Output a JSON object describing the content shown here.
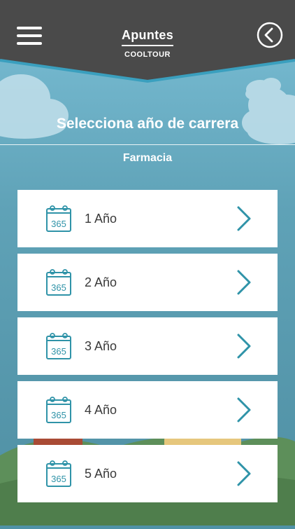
{
  "header": {
    "title": "Apuntes",
    "subtitle": "COOLTOUR"
  },
  "main": {
    "heading": "Selecciona año de carrera",
    "career": "Farmacia",
    "years": [
      {
        "label": "1 Año",
        "icon_text": "365"
      },
      {
        "label": "2 Año",
        "icon_text": "365"
      },
      {
        "label": "3 Año",
        "icon_text": "365"
      },
      {
        "label": "4 Año",
        "icon_text": "365"
      },
      {
        "label": "5 Año",
        "icon_text": "365"
      }
    ]
  },
  "icons": {
    "menu": "hamburger-menu-icon",
    "back": "chevron-left-circle-icon",
    "calendar": "calendar-365-icon",
    "chevron": "chevron-right-icon"
  },
  "colors": {
    "header_bg": "#474747",
    "background": "#5a9cb0",
    "accent": "#2f93a8",
    "card_bg": "#ffffff"
  }
}
